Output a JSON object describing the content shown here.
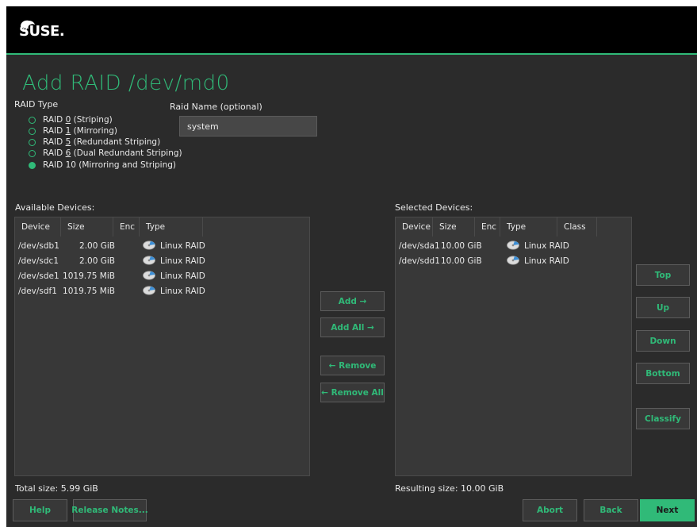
{
  "header": {
    "logo_text": "SUSE."
  },
  "page": {
    "title": "Add RAID /dev/md0"
  },
  "raid_type": {
    "label": "RAID Type",
    "options": [
      {
        "pre": "RAID ",
        "key": "0",
        "post": " (Striping)",
        "selected": false
      },
      {
        "pre": "RAID ",
        "key": "1",
        "post": " (Mirroring)",
        "selected": false
      },
      {
        "pre": "RAID ",
        "key": "5",
        "post": " (Redundant Striping)",
        "selected": false
      },
      {
        "pre": "RAID ",
        "key": "6",
        "post": " (Dual Redundant Striping)",
        "selected": false
      },
      {
        "pre": "RAID 10 (Mirroring and Striping)",
        "key": "",
        "post": "",
        "selected": true
      }
    ]
  },
  "raid_name": {
    "label": "Raid Name (optional)",
    "value": "system"
  },
  "available": {
    "label": "Available Devices:",
    "columns": [
      "Device",
      "Size",
      "Enc",
      "Type"
    ],
    "rows": [
      {
        "device": "/dev/sdb1",
        "size": "2.00 GiB",
        "enc": "",
        "type": "Linux RAID"
      },
      {
        "device": "/dev/sdc1",
        "size": "2.00 GiB",
        "enc": "",
        "type": "Linux RAID"
      },
      {
        "device": "/dev/sde1",
        "size": "1019.75 MiB",
        "enc": "",
        "type": "Linux RAID"
      },
      {
        "device": "/dev/sdf1",
        "size": "1019.75 MiB",
        "enc": "",
        "type": "Linux RAID"
      }
    ],
    "total": "Total size: 5.99 GiB"
  },
  "selected": {
    "label": "Selected Devices:",
    "columns": [
      "Device",
      "Size",
      "Enc",
      "Type",
      "Class"
    ],
    "rows": [
      {
        "device": "/dev/sda1",
        "size": "10.00 GiB",
        "enc": "",
        "type": "Linux RAID",
        "class": ""
      },
      {
        "device": "/dev/sdd1",
        "size": "10.00 GiB",
        "enc": "",
        "type": "Linux RAID",
        "class": ""
      }
    ],
    "total": "Resulting size: 10.00 GiB"
  },
  "transfer_buttons": {
    "add": "Add →",
    "add_all": "Add All →",
    "remove": "← Remove",
    "remove_all": "← Remove All"
  },
  "order_buttons": {
    "top": "Top",
    "up": "Up",
    "down": "Down",
    "bottom": "Bottom",
    "classify": "Classify"
  },
  "footer": {
    "help": "Help",
    "release_notes": "Release Notes...",
    "abort": "Abort",
    "back": "Back",
    "next": "Next"
  },
  "colors": {
    "accent": "#30ba78",
    "background": "#2b2b2b",
    "header": "#000000"
  }
}
